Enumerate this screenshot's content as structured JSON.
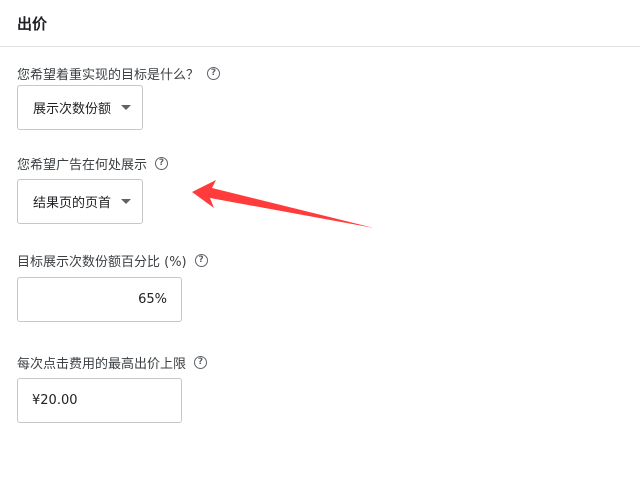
{
  "header": {
    "title": "出价"
  },
  "goal": {
    "label": "您希望着重实现的目标是什么？",
    "selected": "展示次数份额"
  },
  "location": {
    "label": "您希望广告在何处展示",
    "selected": "结果页的页首"
  },
  "share": {
    "label": "目标展示次数份额百分比 (%)",
    "value": "65%"
  },
  "max_cpc": {
    "label": "每次点击费用的最高出价上限",
    "value": "¥20.00"
  },
  "help_icon_glyph": "?",
  "annotation_color": "#ff3b3b"
}
